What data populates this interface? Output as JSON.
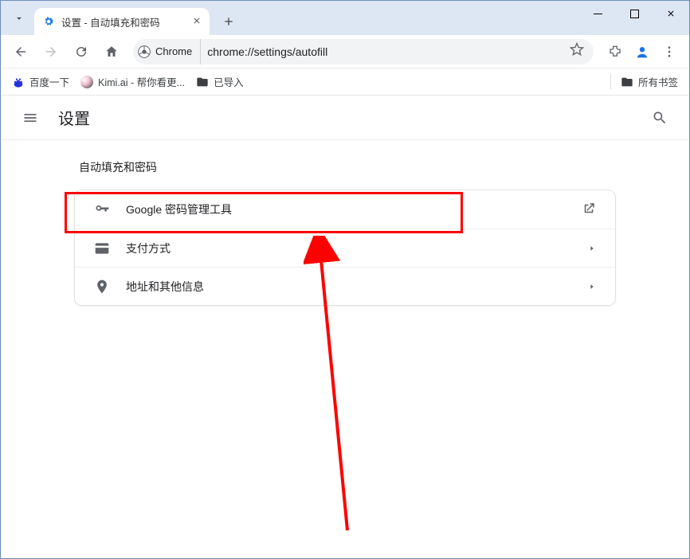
{
  "window": {
    "tab_title": "设置 - 自动填充和密码"
  },
  "toolbar": {
    "omnibox_chip": "Chrome",
    "url": "chrome://settings/autofill"
  },
  "bookmarks": {
    "item1": "百度一下",
    "item2": "Kimi.ai - 帮你看更...",
    "item3": "已导入",
    "all": "所有书签"
  },
  "settings": {
    "title": "设置",
    "section_title": "自动填充和密码",
    "rows": {
      "password": "Google 密码管理工具",
      "payment": "支付方式",
      "address": "地址和其他信息"
    }
  }
}
